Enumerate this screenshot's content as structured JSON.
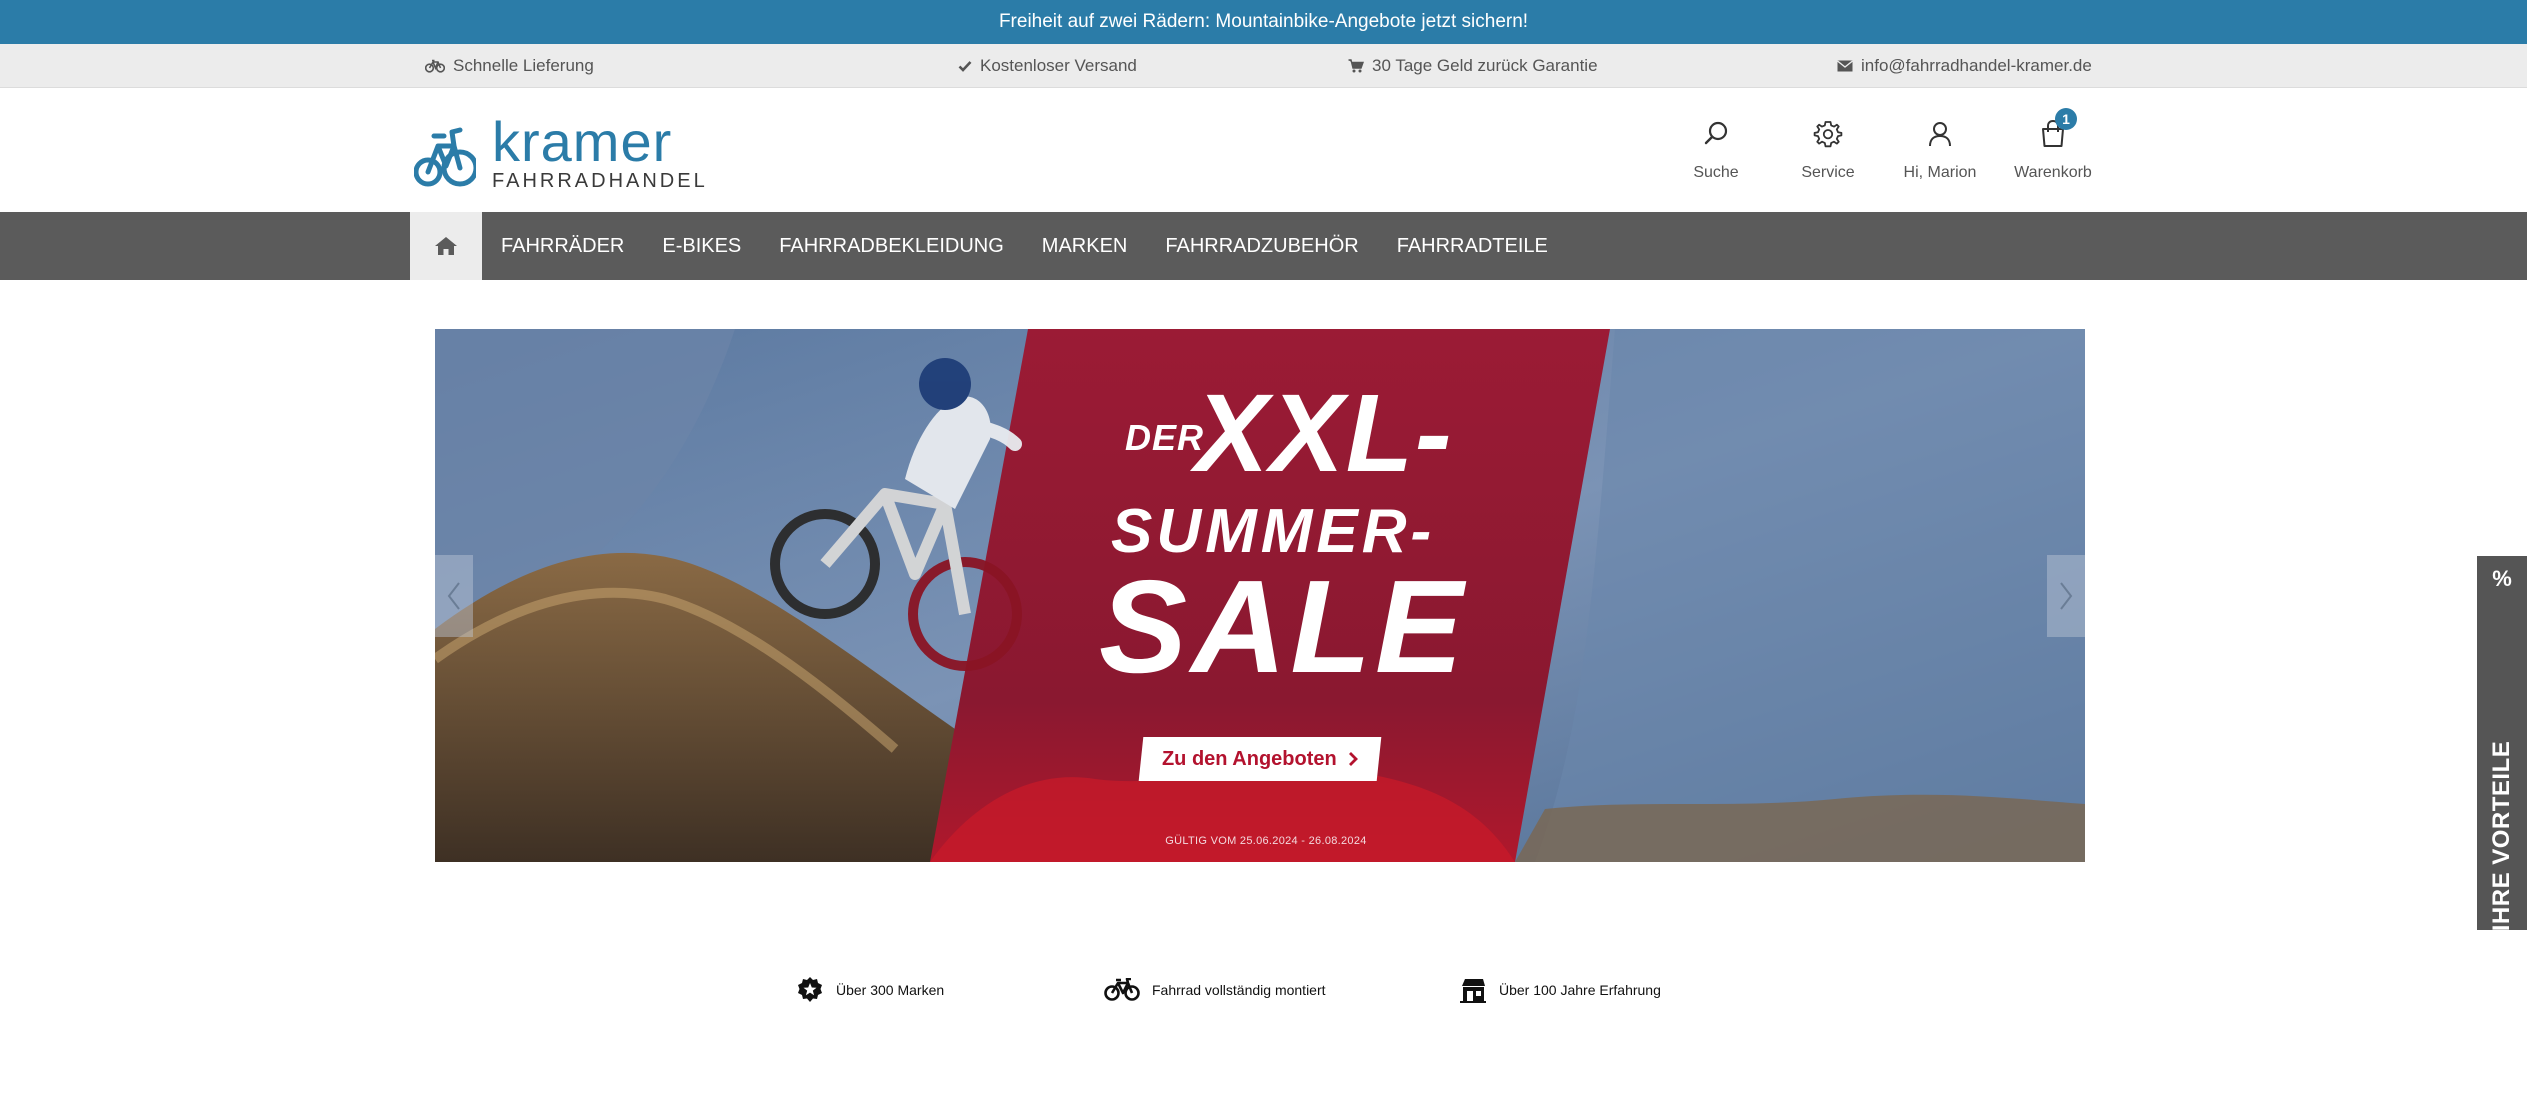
{
  "promo": {
    "text": "Freiheit auf zwei Rädern: Mountainbike-Angebote jetzt sichern!"
  },
  "usp": [
    {
      "icon": "bicycle-icon",
      "label": "Schnelle Lieferung"
    },
    {
      "icon": "check-icon",
      "label": "Kostenloser Versand"
    },
    {
      "icon": "cart-icon",
      "label": "30 Tage Geld zurück Garantie"
    },
    {
      "icon": "envelope-icon",
      "label": "info@fahrradhandel-kramer.de"
    }
  ],
  "logo": {
    "name": "kramer",
    "sub": "FAHRRADHANDEL"
  },
  "header": {
    "search_label": "Suche",
    "service_label": "Service",
    "account_label": "Hi, Marion",
    "cart_label": "Warenkorb",
    "cart_count": "1"
  },
  "nav": {
    "home_icon": "home-icon",
    "items": [
      "FAHRRÄDER",
      "E-BIKES",
      "FAHRRADBEKLEIDUNG",
      "MARKEN",
      "FAHRRADZUBEHÖR",
      "FAHRRADTEILE"
    ]
  },
  "hero": {
    "headline_der": "DER",
    "headline_xxl": "XXL-",
    "headline_summer": "SUMMER-",
    "headline_sale": "SALE",
    "cta_label": "Zu den Angeboten",
    "validity": "GÜLTIG VOM 25.06.2024 - 26.08.2024",
    "accent_color": "#9b1b35"
  },
  "benefits": [
    {
      "icon": "badge-star-icon",
      "label": "Über 300 Marken"
    },
    {
      "icon": "bicycle-icon",
      "label": "Fahrrad vollständig montiert"
    },
    {
      "icon": "shop-icon",
      "label": "Über 100 Jahre Erfahrung"
    }
  ],
  "side_tab": {
    "symbol": "%",
    "label": "IHRE VORTEILE"
  },
  "colors": {
    "brand": "#2b7ca8",
    "nav_bg": "#5b5b5b",
    "usp_bg": "#ececec",
    "side_tab": "#555555"
  }
}
